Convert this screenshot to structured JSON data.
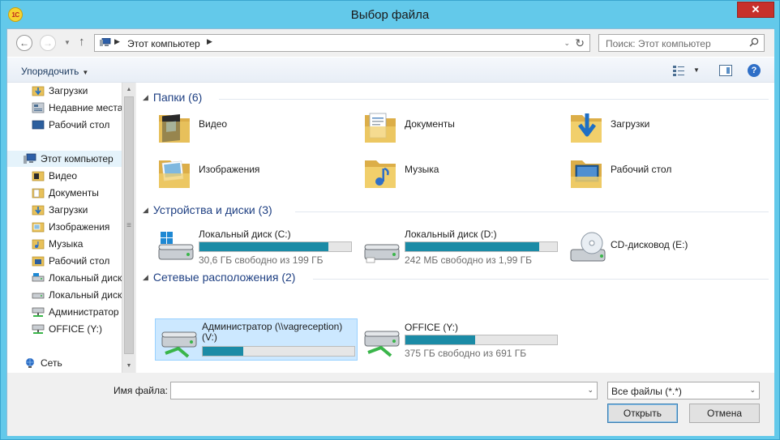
{
  "window": {
    "title": "Выбор файла",
    "app_logo": "1С",
    "close_label": "✕"
  },
  "address_bar": {
    "path": "Этот компьютер",
    "search_placeholder": "Поиск: Этот компьютер"
  },
  "toolbar": {
    "organize_label": "Упорядочить"
  },
  "nav_pane": {
    "items": [
      {
        "label": "Загрузки",
        "icon": "downloads-folder-icon"
      },
      {
        "label": "Недавние места",
        "icon": "recent-places-icon"
      },
      {
        "label": "Рабочий стол",
        "icon": "desktop-icon"
      },
      {
        "label": "Этот компьютер",
        "icon": "computer-icon"
      },
      {
        "label": "Видео",
        "icon": "video-folder-icon"
      },
      {
        "label": "Документы",
        "icon": "documents-folder-icon"
      },
      {
        "label": "Загрузки",
        "icon": "downloads-folder-icon"
      },
      {
        "label": "Изображения",
        "icon": "pictures-folder-icon"
      },
      {
        "label": "Музыка",
        "icon": "music-folder-icon"
      },
      {
        "label": "Рабочий стол",
        "icon": "desktop-folder-icon"
      },
      {
        "label": "Локальный диск",
        "icon": "local-disk-icon"
      },
      {
        "label": "Локальный диск",
        "icon": "local-disk-icon"
      },
      {
        "label": "Администратор",
        "icon": "network-drive-icon"
      },
      {
        "label": "OFFICE (Y:)",
        "icon": "network-drive-icon"
      },
      {
        "label": "Сеть",
        "icon": "network-icon"
      }
    ]
  },
  "groups": {
    "folders": {
      "header": "Папки (6)",
      "items": [
        {
          "label": "Видео",
          "icon": "video-folder-icon"
        },
        {
          "label": "Документы",
          "icon": "documents-folder-icon"
        },
        {
          "label": "Загрузки",
          "icon": "downloads-folder-icon"
        },
        {
          "label": "Изображения",
          "icon": "pictures-folder-icon"
        },
        {
          "label": "Музыка",
          "icon": "music-folder-icon"
        },
        {
          "label": "Рабочий стол",
          "icon": "desktop-folder-icon"
        }
      ]
    },
    "devices": {
      "header": "Устройства и диски (3)",
      "items": [
        {
          "label": "Локальный диск (C:)",
          "free": "30,6 ГБ свободно из 199 ГБ",
          "used_fraction": 0.85,
          "icon": "windows-drive-icon"
        },
        {
          "label": "Локальный диск (D:)",
          "free": "242 МБ свободно из 1,99 ГБ",
          "used_fraction": 0.88,
          "icon": "local-disk-icon"
        },
        {
          "label": "CD-дисковод (E:)",
          "icon": "cd-drive-icon"
        }
      ]
    },
    "network": {
      "header": "Сетевые расположения (2)",
      "items": [
        {
          "label": "Администратор (\\\\vagreception)",
          "label2": "(V:)",
          "used_fraction": 0.27,
          "icon": "network-drive-icon"
        },
        {
          "label": "OFFICE (Y:)",
          "free": "375 ГБ свободно из 691 ГБ",
          "used_fraction": 0.46,
          "icon": "network-drive-icon"
        }
      ]
    }
  },
  "bottom": {
    "filename_label": "Имя файла:",
    "filename_value": "",
    "filter_value": "Все файлы (*.*)",
    "open_label": "Открыть",
    "cancel_label": "Отмена"
  },
  "colors": {
    "titlebar": "#63c9ea",
    "close": "#c7302b",
    "bar_fill": "#1b8ba6",
    "header_text": "#1e3f82",
    "selection": "#cce8ff"
  }
}
